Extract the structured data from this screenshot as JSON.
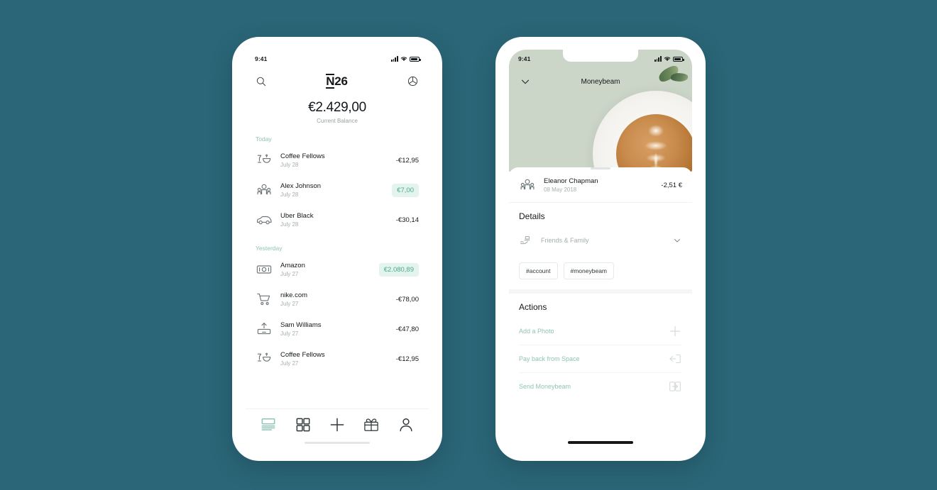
{
  "background_color": "#2a6678",
  "accent_color": "#8fc4b6",
  "positive_amount_color": "#4aa98d",
  "positive_badge_bg": "#e3f3ee",
  "left_phone": {
    "status_bar": {
      "time": "9:41",
      "signal_icon": "signal-bars-icon",
      "wifi_icon": "wifi-icon",
      "battery_icon": "battery-icon"
    },
    "header": {
      "search_icon": "search-icon",
      "logo": "N26",
      "logo_letter": "N",
      "logo_rest": "26",
      "settings_icon": "compass-wheel-icon"
    },
    "balance": {
      "amount": "€2.429,00",
      "label": "Current Balance"
    },
    "groups": [
      {
        "label": "Today",
        "transactions": [
          {
            "icon": "coffee-icon",
            "name": "Coffee Fellows",
            "date": "July 28",
            "amount": "-€12,95",
            "positive": false
          },
          {
            "icon": "people-icon",
            "name": "Alex Johnson",
            "date": "July 28",
            "amount": "€7,00",
            "positive": true
          },
          {
            "icon": "car-icon",
            "name": "Uber Black",
            "date": "July 28",
            "amount": "-€30,14",
            "positive": false
          }
        ]
      },
      {
        "label": "Yesterday",
        "transactions": [
          {
            "icon": "banknote-icon",
            "name": "Amazon",
            "date": "July 27",
            "amount": "€2.080,89",
            "positive": true
          },
          {
            "icon": "cart-icon",
            "name": "nike.com",
            "date": "July 27",
            "amount": "-€78,00",
            "positive": false
          },
          {
            "icon": "upload-icon",
            "name": "Sam Williams",
            "date": "July 27",
            "amount": "-€47,80",
            "positive": false
          },
          {
            "icon": "coffee-icon",
            "name": "Coffee Fellows",
            "date": "July 27",
            "amount": "-€12,95",
            "positive": false
          }
        ]
      }
    ],
    "tabbar": [
      {
        "icon": "statement-icon",
        "active": true
      },
      {
        "icon": "grid-icon",
        "active": false
      },
      {
        "icon": "plus-icon",
        "active": false
      },
      {
        "icon": "gift-icon",
        "active": false
      },
      {
        "icon": "person-icon",
        "active": false
      }
    ]
  },
  "right_phone": {
    "status_bar": {
      "time": "9:41",
      "signal_icon": "signal-bars-icon",
      "wifi_icon": "wifi-icon",
      "battery_icon": "battery-icon"
    },
    "hero": {
      "back_icon": "chevron-down-icon",
      "title": "Moneybeam",
      "photo": "latte-coffee-photo",
      "bg_color": "#ccd6c8"
    },
    "transaction": {
      "icon": "people-icon",
      "name": "Eleanor Chapman",
      "date": "08 May 2018",
      "amount": "-2,51 €"
    },
    "details": {
      "title": "Details",
      "category": {
        "icon": "hand-coins-icon",
        "label": "Friends & Family",
        "chevron_icon": "chevron-down-icon"
      },
      "tags": [
        "#account",
        "#moneybeam"
      ]
    },
    "actions": {
      "title": "Actions",
      "items": [
        {
          "label": "Add a Photo",
          "icon": "plus-icon"
        },
        {
          "label": "Pay back from Space",
          "icon": "arrow-into-box-icon"
        },
        {
          "label": "Send Moneybeam",
          "icon": "phone-transfer-icon"
        }
      ]
    }
  }
}
